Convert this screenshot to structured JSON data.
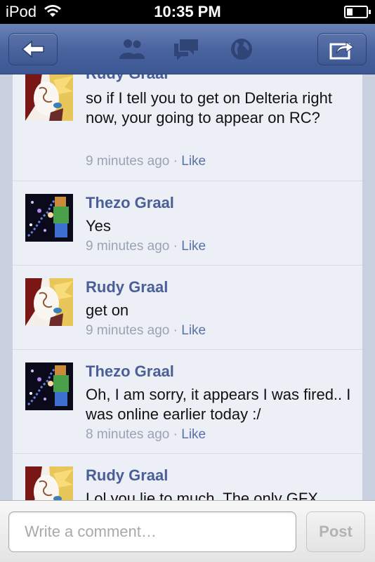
{
  "status_bar": {
    "carrier": "iPod",
    "time": "10:35 PM"
  },
  "nav": {
    "icons": [
      "back-arrow-icon",
      "friends-icon",
      "messages-icon",
      "globe-icon",
      "share-icon"
    ]
  },
  "comments": [
    {
      "author": "Rudy Graal",
      "avatar": "rudy-avatar",
      "text": "so if I tell you to get on Delteria right now, your going to appear on RC?",
      "time": "9 minutes ago",
      "separator": "·",
      "like": "Like"
    },
    {
      "author": "Thezo Graal",
      "avatar": "thezo-avatar",
      "text": "Yes",
      "time": "9 minutes ago",
      "separator": "·",
      "like": "Like"
    },
    {
      "author": "Rudy Graal",
      "avatar": "rudy-avatar",
      "text": "get on",
      "time": "9 minutes ago",
      "separator": "·",
      "like": "Like"
    },
    {
      "author": "Thezo Graal",
      "avatar": "thezo-avatar",
      "text": "Oh, I am sorry, it appears I was fired.. I was online earlier today :/",
      "time": "8 minutes ago",
      "separator": "·",
      "like": "Like"
    },
    {
      "author": "Rudy Graal",
      "avatar": "rudy-avatar",
      "text": "Lol you lie to much. The only GFX",
      "time": "",
      "separator": "",
      "like": ""
    }
  ],
  "composer": {
    "placeholder": "Write a comment…",
    "post_label": "Post"
  },
  "colors": {
    "nav_blue": "#4a64a0",
    "author_blue": "#4a5f96",
    "feed_bg": "#eceff6"
  }
}
